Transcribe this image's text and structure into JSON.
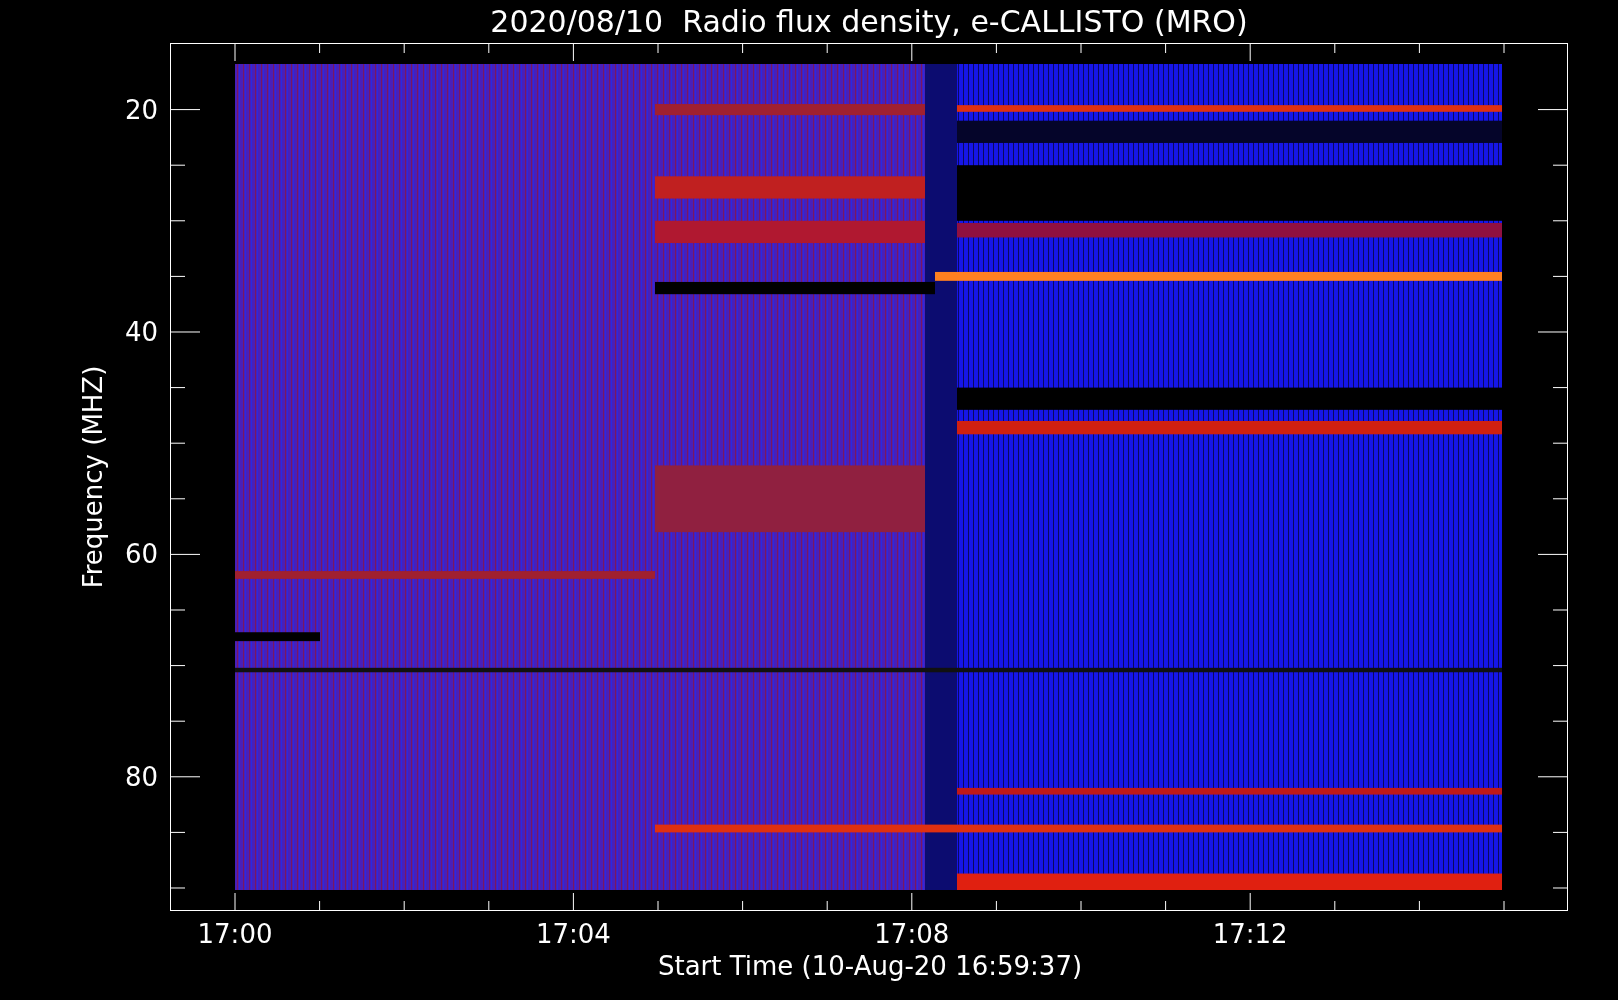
{
  "title": "2020/08/10  Radio flux density, e-CALLISTO (MRO)",
  "y_axis": {
    "label": "Frequency (MHZ)",
    "ticks": [
      "20",
      "40",
      "60",
      "80"
    ]
  },
  "x_axis": {
    "label": "Start Time (10-Aug-20 16:59:37)",
    "ticks": [
      "17:00",
      "17:04",
      "17:08",
      "17:12"
    ]
  }
}
